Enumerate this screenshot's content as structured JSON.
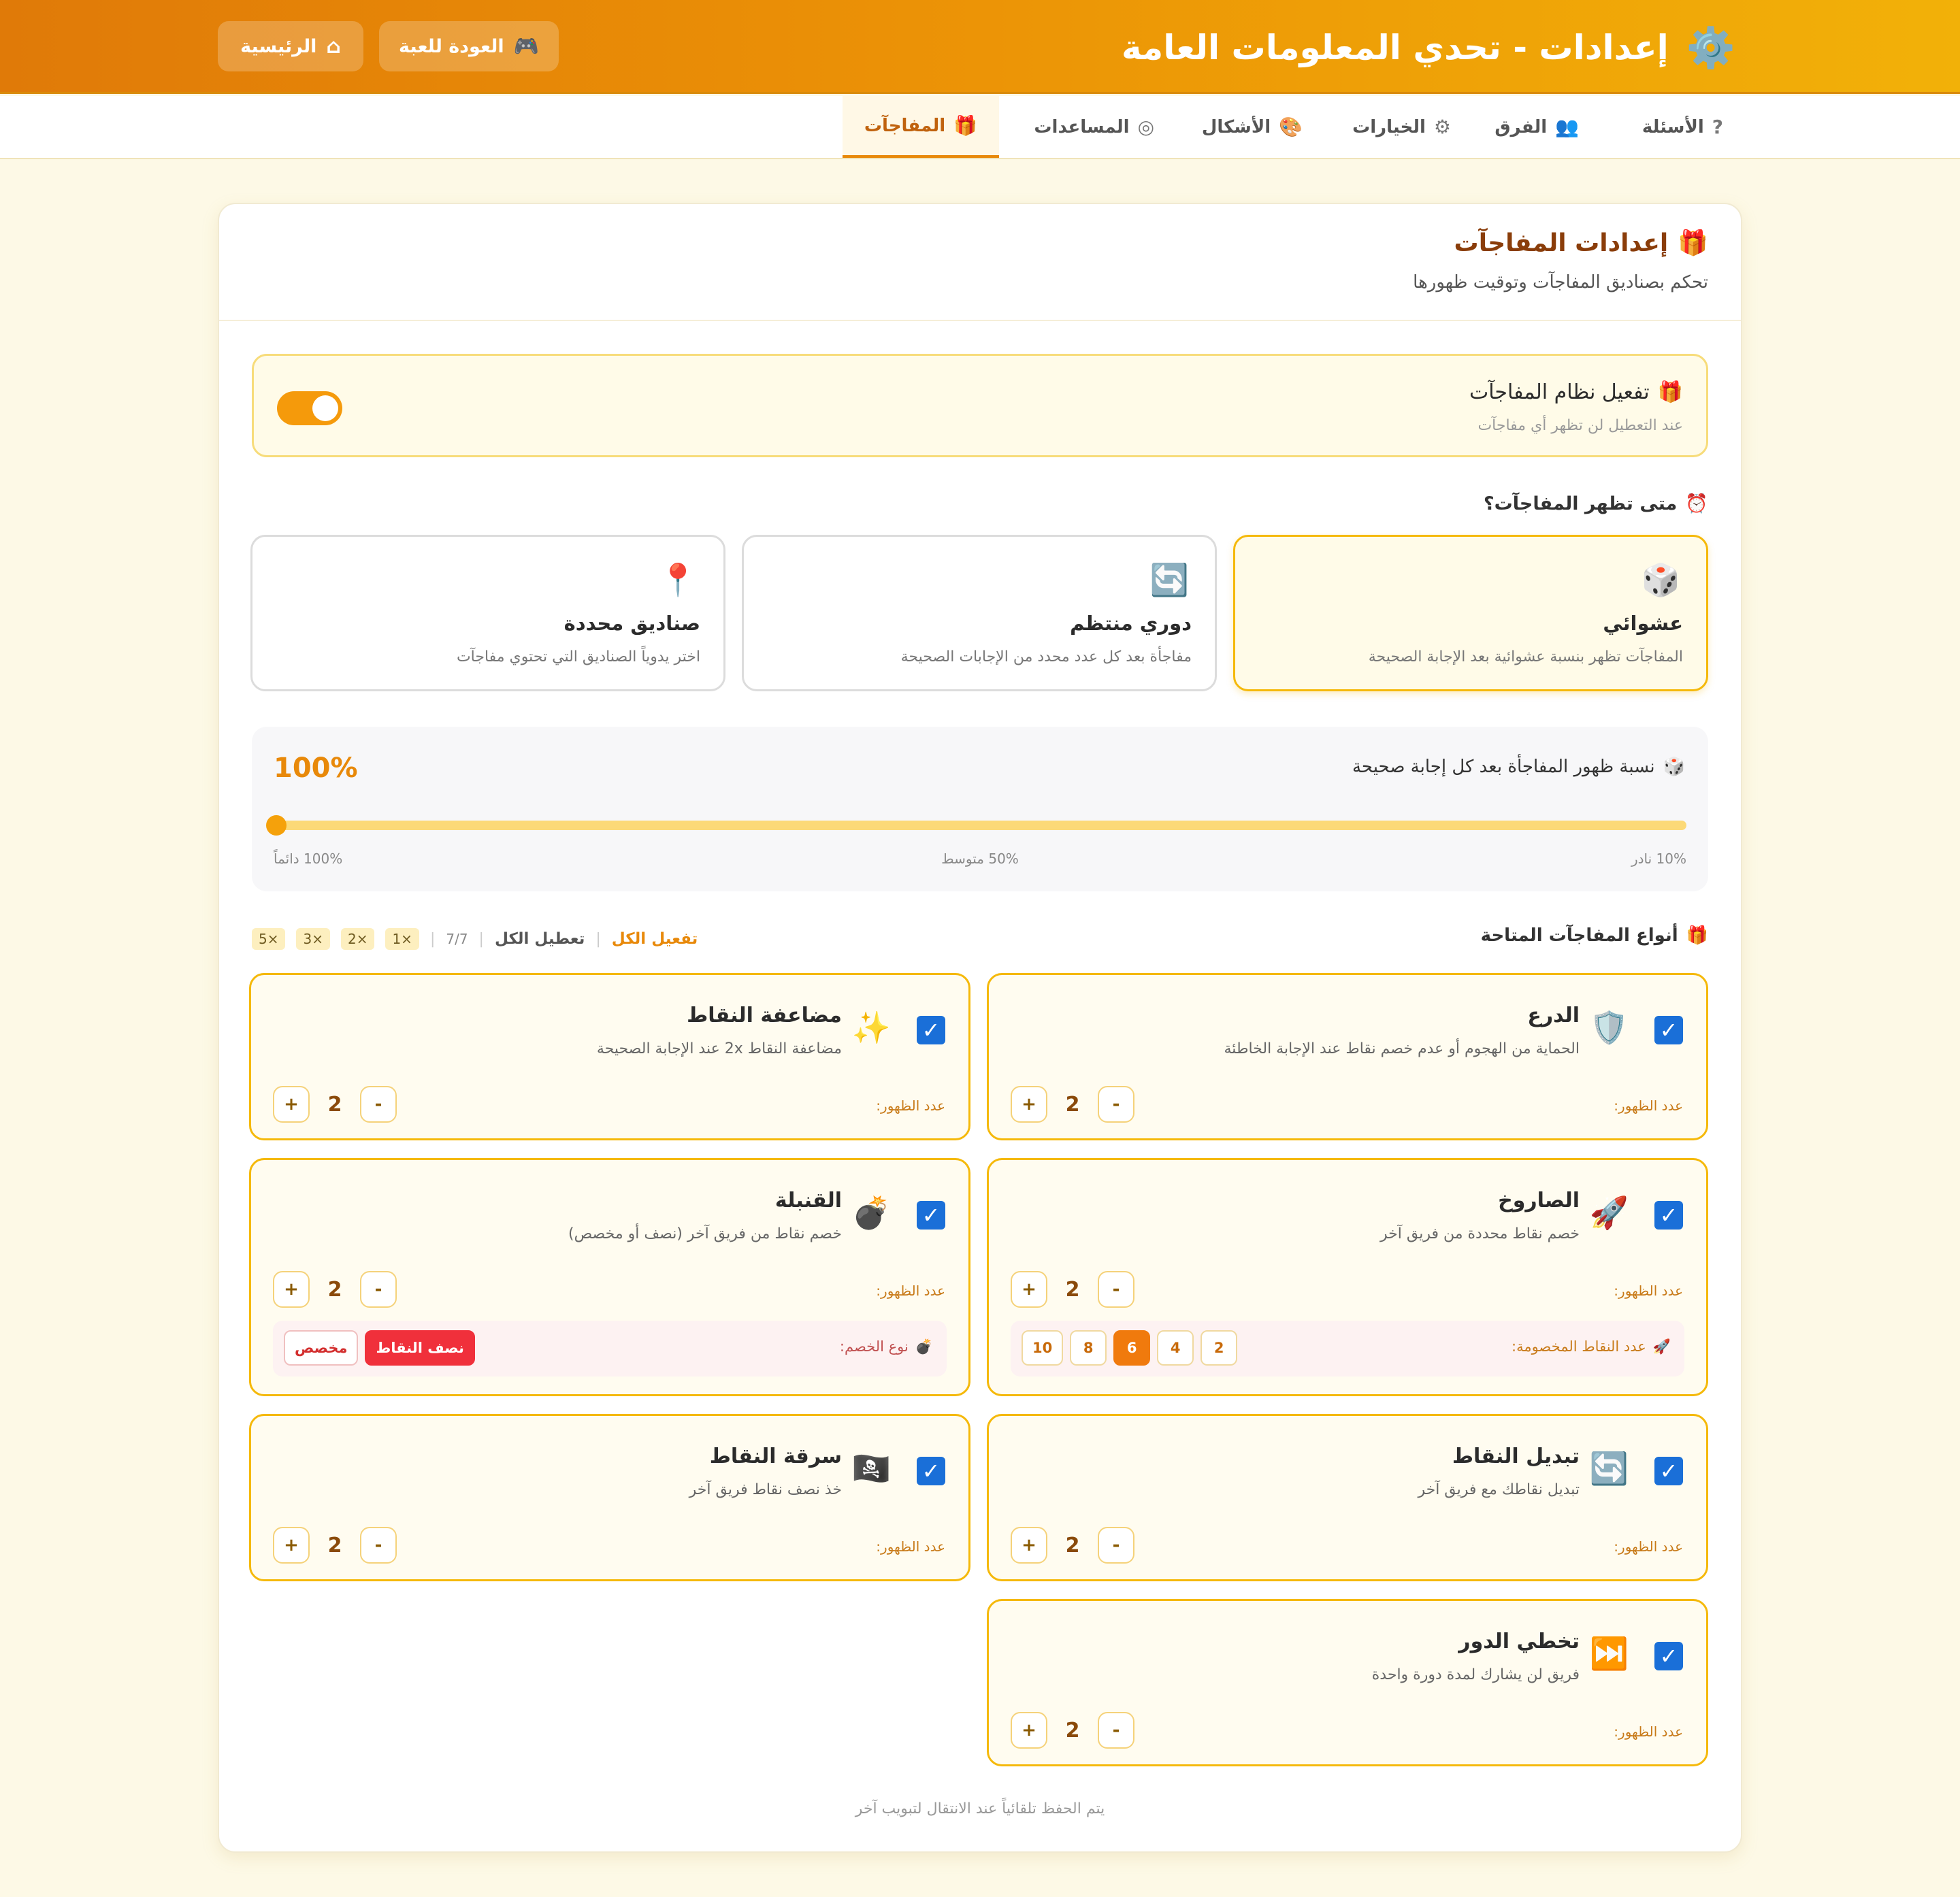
{
  "header": {
    "title": "إعدادات - تحدي المعلومات العامة",
    "title_icon": "⚙️",
    "back_button": "العودة للعبة",
    "home_button": "الرئيسية",
    "back_icon": "🎮",
    "home_icon": "⌂"
  },
  "tabs": [
    {
      "label": "الأسئلة",
      "icon": "?"
    },
    {
      "label": "الفرق",
      "icon": "👥"
    },
    {
      "label": "الخيارات",
      "icon": "⚙"
    },
    {
      "label": "الأشكال",
      "icon": "🎨"
    },
    {
      "label": "المساعدات",
      "icon": "◎"
    },
    {
      "label": "المفاجآت",
      "icon": "🎁",
      "active": true
    }
  ],
  "card": {
    "title": "إعدادات المفاجآت",
    "title_icon": "🎁",
    "subtitle": "تحكم بصناديق المفاجآت وتوقيت ظهورها"
  },
  "enable": {
    "title": "تفعيل نظام المفاجآت",
    "icon": "🎁",
    "desc": "عند التعطيل لن تظهر أي مفاجآت",
    "on": true
  },
  "when": {
    "title": "متى تظهر المفاجآت؟",
    "icon": "⏰",
    "modes": [
      {
        "name": "عشوائي",
        "desc": "المفاجآت تظهر بنسبة عشوائية بعد الإجابة الصحيحة",
        "icon": "🎲",
        "selected": true
      },
      {
        "name": "دوري منتظم",
        "desc": "مفاجأة بعد كل عدد محدد من الإجابات الصحيحة",
        "icon": "🔄"
      },
      {
        "name": "صناديق محددة",
        "desc": "اختر يدوياً الصناديق التي تحتوي مفاجآت",
        "icon": "📍"
      }
    ]
  },
  "probability": {
    "label": "نسبة ظهور المفاجأة بعد كل إجابة صحيحة",
    "icon": "🎲",
    "value_text": "100%",
    "value": 100,
    "min": 10,
    "max": 100,
    "tick_rare": "10% نادر",
    "tick_mid": "50% متوسط",
    "tick_always": "100% دائماً"
  },
  "types": {
    "title": "أنواع المفاجآت المتاحة",
    "icon": "🎁",
    "enable_all": "تفعيل الكل",
    "disable_all": "تعطيل الكل",
    "count": "7/7",
    "multipliers": [
      "1×",
      "2×",
      "3×",
      "5×"
    ],
    "qty_label": "عدد الظهور:",
    "items": {
      "shield": {
        "name": "الدرع",
        "desc": "الحماية من الهجوم أو عدم خصم نقاط عند الإجابة الخاطئة",
        "icon": "🛡️",
        "qty": "2"
      },
      "double": {
        "name": "مضاعفة النقاط",
        "desc": "مضاعفة النقاط 2x عند الإجابة الصحيحة",
        "icon": "✨",
        "qty": "2"
      },
      "rocket": {
        "name": "الصاروخ",
        "desc": "خصم نقاط محددة من فريق آخر",
        "icon": "🚀",
        "qty": "2",
        "sub_label": "عدد النقاط المخصومة:",
        "sub_icon": "🚀",
        "options": [
          "2",
          "4",
          "6",
          "8",
          "10"
        ],
        "selected": "6"
      },
      "bomb": {
        "name": "القنبلة",
        "desc": "خصم نقاط من فريق آخر (نصف أو مخصص)",
        "icon": "💣",
        "qty": "2",
        "sub_label": "نوع الخصم:",
        "sub_icon": "💣",
        "opt_half": "نصف النقاط",
        "opt_custom": "مخصص"
      },
      "swap": {
        "name": "تبديل النقاط",
        "desc": "تبديل نقاطك مع فريق آخر",
        "icon": "🔄",
        "qty": "2"
      },
      "steal": {
        "name": "سرقة النقاط",
        "desc": "خذ نصف نقاط فريق آخر",
        "icon": "🏴‍☠️",
        "qty": "2"
      },
      "skip": {
        "name": "تخطي الدور",
        "desc": "فريق لن يشارك لمدة دورة واحدة",
        "icon": "⏭️",
        "qty": "2"
      }
    }
  },
  "footer_note": "يتم الحفظ تلقائياً عند الانتقال لتبويب آخر",
  "colors": {
    "accent": "#f59a0b",
    "brand_dark": "#8a3d0a",
    "check": "#1a6fd8",
    "danger": "#f0303b"
  }
}
